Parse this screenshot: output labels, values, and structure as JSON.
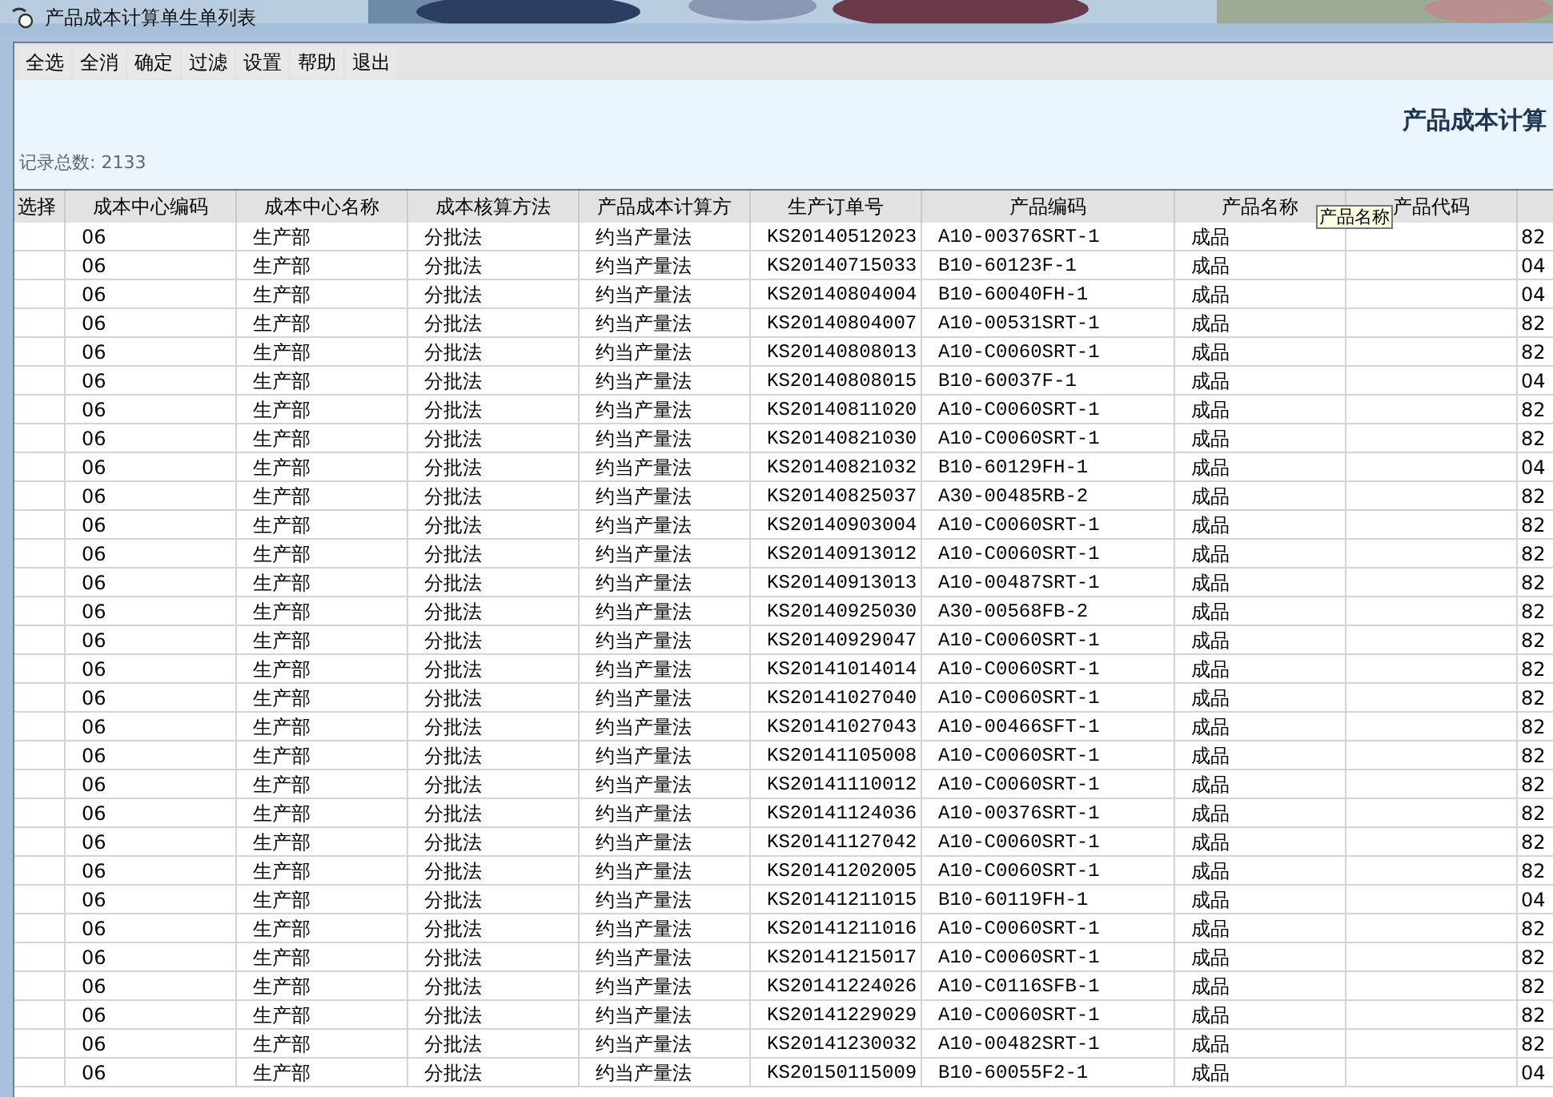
{
  "window": {
    "title": "产品成本计算单生单列表"
  },
  "toolbar": [
    "全选",
    "全消",
    "确定",
    "过滤",
    "设置",
    "帮助",
    "退出"
  ],
  "heading": "产品成本计算",
  "record_count": "记录总数: 2133",
  "table": {
    "columns": [
      "选择",
      "成本中心编码",
      "成本中心名称",
      "成本核算方法",
      "产品成本计算方",
      "生产订单号",
      "产品编码",
      "产品名称",
      "产品代码"
    ],
    "tooltip": "产品名称",
    "rows": [
      {
        "center_code": "06",
        "center_name": "生产部",
        "costing": "分批法",
        "calc": "约当产量法",
        "order": "KS20140512023",
        "product_code": "A10-00376SRT-1",
        "product_name": "成品",
        "column_10": "82"
      },
      {
        "center_code": "06",
        "center_name": "生产部",
        "costing": "分批法",
        "calc": "约当产量法",
        "order": "KS20140715033",
        "product_code": "B10-60123F-1",
        "product_name": "成品",
        "column_10": "04"
      },
      {
        "center_code": "06",
        "center_name": "生产部",
        "costing": "分批法",
        "calc": "约当产量法",
        "order": "KS20140804004",
        "product_code": "B10-60040FH-1",
        "product_name": "成品",
        "column_10": "04"
      },
      {
        "center_code": "06",
        "center_name": "生产部",
        "costing": "分批法",
        "calc": "约当产量法",
        "order": "KS20140804007",
        "product_code": "A10-00531SRT-1",
        "product_name": "成品",
        "column_10": "82"
      },
      {
        "center_code": "06",
        "center_name": "生产部",
        "costing": "分批法",
        "calc": "约当产量法",
        "order": "KS20140808013",
        "product_code": "A10-C0060SRT-1",
        "product_name": "成品",
        "column_10": "82"
      },
      {
        "center_code": "06",
        "center_name": "生产部",
        "costing": "分批法",
        "calc": "约当产量法",
        "order": "KS20140808015",
        "product_code": "B10-60037F-1",
        "product_name": "成品",
        "column_10": "04"
      },
      {
        "center_code": "06",
        "center_name": "生产部",
        "costing": "分批法",
        "calc": "约当产量法",
        "order": "KS20140811020",
        "product_code": "A10-C0060SRT-1",
        "product_name": "成品",
        "column_10": "82"
      },
      {
        "center_code": "06",
        "center_name": "生产部",
        "costing": "分批法",
        "calc": "约当产量法",
        "order": "KS20140821030",
        "product_code": "A10-C0060SRT-1",
        "product_name": "成品",
        "column_10": "82"
      },
      {
        "center_code": "06",
        "center_name": "生产部",
        "costing": "分批法",
        "calc": "约当产量法",
        "order": "KS20140821032",
        "product_code": "B10-60129FH-1",
        "product_name": "成品",
        "column_10": "04"
      },
      {
        "center_code": "06",
        "center_name": "生产部",
        "costing": "分批法",
        "calc": "约当产量法",
        "order": "KS20140825037",
        "product_code": "A30-00485RB-2",
        "product_name": "成品",
        "column_10": "82"
      },
      {
        "center_code": "06",
        "center_name": "生产部",
        "costing": "分批法",
        "calc": "约当产量法",
        "order": "KS20140903004",
        "product_code": "A10-C0060SRT-1",
        "product_name": "成品",
        "column_10": "82"
      },
      {
        "center_code": "06",
        "center_name": "生产部",
        "costing": "分批法",
        "calc": "约当产量法",
        "order": "KS20140913012",
        "product_code": "A10-C0060SRT-1",
        "product_name": "成品",
        "column_10": "82"
      },
      {
        "center_code": "06",
        "center_name": "生产部",
        "costing": "分批法",
        "calc": "约当产量法",
        "order": "KS20140913013",
        "product_code": "A10-00487SRT-1",
        "product_name": "成品",
        "column_10": "82"
      },
      {
        "center_code": "06",
        "center_name": "生产部",
        "costing": "分批法",
        "calc": "约当产量法",
        "order": "KS20140925030",
        "product_code": "A30-00568FB-2",
        "product_name": "成品",
        "column_10": "82"
      },
      {
        "center_code": "06",
        "center_name": "生产部",
        "costing": "分批法",
        "calc": "约当产量法",
        "order": "KS20140929047",
        "product_code": "A10-C0060SRT-1",
        "product_name": "成品",
        "column_10": "82"
      },
      {
        "center_code": "06",
        "center_name": "生产部",
        "costing": "分批法",
        "calc": "约当产量法",
        "order": "KS20141014014",
        "product_code": "A10-C0060SRT-1",
        "product_name": "成品",
        "column_10": "82"
      },
      {
        "center_code": "06",
        "center_name": "生产部",
        "costing": "分批法",
        "calc": "约当产量法",
        "order": "KS20141027040",
        "product_code": "A10-C0060SRT-1",
        "product_name": "成品",
        "column_10": "82"
      },
      {
        "center_code": "06",
        "center_name": "生产部",
        "costing": "分批法",
        "calc": "约当产量法",
        "order": "KS20141027043",
        "product_code": "A10-00466SFT-1",
        "product_name": "成品",
        "column_10": "82"
      },
      {
        "center_code": "06",
        "center_name": "生产部",
        "costing": "分批法",
        "calc": "约当产量法",
        "order": "KS20141105008",
        "product_code": "A10-C0060SRT-1",
        "product_name": "成品",
        "column_10": "82"
      },
      {
        "center_code": "06",
        "center_name": "生产部",
        "costing": "分批法",
        "calc": "约当产量法",
        "order": "KS20141110012",
        "product_code": "A10-C0060SRT-1",
        "product_name": "成品",
        "column_10": "82"
      },
      {
        "center_code": "06",
        "center_name": "生产部",
        "costing": "分批法",
        "calc": "约当产量法",
        "order": "KS20141124036",
        "product_code": "A10-00376SRT-1",
        "product_name": "成品",
        "column_10": "82"
      },
      {
        "center_code": "06",
        "center_name": "生产部",
        "costing": "分批法",
        "calc": "约当产量法",
        "order": "KS20141127042",
        "product_code": "A10-C0060SRT-1",
        "product_name": "成品",
        "column_10": "82"
      },
      {
        "center_code": "06",
        "center_name": "生产部",
        "costing": "分批法",
        "calc": "约当产量法",
        "order": "KS20141202005",
        "product_code": "A10-C0060SRT-1",
        "product_name": "成品",
        "column_10": "82"
      },
      {
        "center_code": "06",
        "center_name": "生产部",
        "costing": "分批法",
        "calc": "约当产量法",
        "order": "KS20141211015",
        "product_code": "B10-60119FH-1",
        "product_name": "成品",
        "column_10": "04"
      },
      {
        "center_code": "06",
        "center_name": "生产部",
        "costing": "分批法",
        "calc": "约当产量法",
        "order": "KS20141211016",
        "product_code": "A10-C0060SRT-1",
        "product_name": "成品",
        "column_10": "82"
      },
      {
        "center_code": "06",
        "center_name": "生产部",
        "costing": "分批法",
        "calc": "约当产量法",
        "order": "KS20141215017",
        "product_code": "A10-C0060SRT-1",
        "product_name": "成品",
        "column_10": "82"
      },
      {
        "center_code": "06",
        "center_name": "生产部",
        "costing": "分批法",
        "calc": "约当产量法",
        "order": "KS20141224026",
        "product_code": "A10-C0116SFB-1",
        "product_name": "成品",
        "column_10": "82"
      },
      {
        "center_code": "06",
        "center_name": "生产部",
        "costing": "分批法",
        "calc": "约当产量法",
        "order": "KS20141229029",
        "product_code": "A10-C0060SRT-1",
        "product_name": "成品",
        "column_10": "82"
      },
      {
        "center_code": "06",
        "center_name": "生产部",
        "costing": "分批法",
        "calc": "约当产量法",
        "order": "KS20141230032",
        "product_code": "A10-00482SRT-1",
        "product_name": "成品",
        "column_10": "82"
      },
      {
        "center_code": "06",
        "center_name": "生产部",
        "costing": "分批法",
        "calc": "约当产量法",
        "order": "KS20150115009",
        "product_code": "B10-60055F2-1",
        "product_name": "成品",
        "column_10": "04"
      }
    ]
  }
}
